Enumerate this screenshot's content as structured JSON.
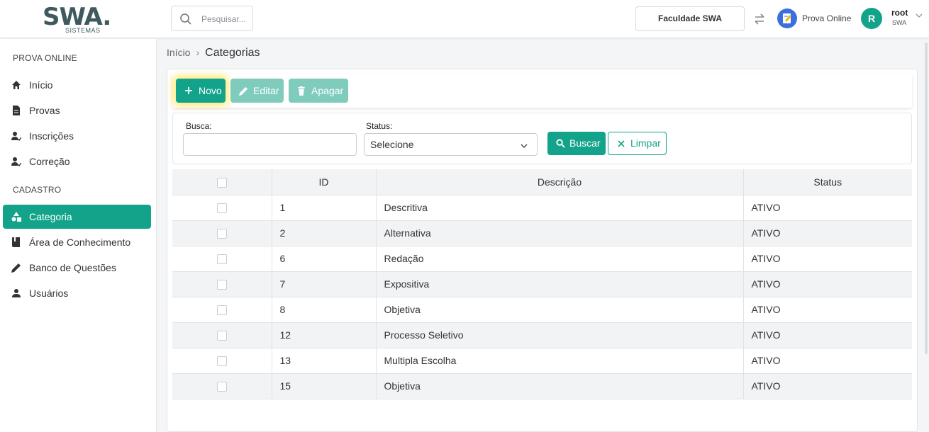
{
  "header": {
    "logo_text": "SWA",
    "logo_sub": "SISTEMAS",
    "search_placeholder": "Pesquisar...",
    "company": "Faculdade SWA",
    "app_label": "Prova Online",
    "avatar_letter": "R",
    "user_name": "root",
    "user_org": "SWA"
  },
  "sidebar": {
    "sections": [
      {
        "title": "PROVA ONLINE",
        "items": [
          {
            "label": "Início",
            "icon": "home-icon"
          },
          {
            "label": "Provas",
            "icon": "document-icon"
          },
          {
            "label": "Inscrições",
            "icon": "user-check-icon"
          },
          {
            "label": "Correção",
            "icon": "user-check-icon"
          }
        ]
      },
      {
        "title": "CADASTRO",
        "items": [
          {
            "label": "Categoria",
            "icon": "shapes-icon",
            "active": true
          },
          {
            "label": "Área de Conhecimento",
            "icon": "book-icon"
          },
          {
            "label": "Banco de Questões",
            "icon": "pencil-icon"
          },
          {
            "label": "Usuários",
            "icon": "user-icon"
          }
        ]
      }
    ]
  },
  "breadcrumb": {
    "home": "Início",
    "current": "Categorias"
  },
  "toolbar": {
    "new_label": "Novo",
    "edit_label": "Editar",
    "delete_label": "Apagar"
  },
  "filter": {
    "search_label": "Busca:",
    "search_value": "",
    "status_label": "Status:",
    "status_value": "Selecione",
    "search_button": "Buscar",
    "clear_button": "Limpar"
  },
  "table": {
    "columns": [
      "ID",
      "Descrição",
      "Status"
    ],
    "rows": [
      {
        "id": "1",
        "descricao": "Descritiva",
        "status": "ATIVO"
      },
      {
        "id": "2",
        "descricao": "Alternativa",
        "status": "ATIVO"
      },
      {
        "id": "6",
        "descricao": "Redação",
        "status": "ATIVO"
      },
      {
        "id": "7",
        "descricao": "Expositiva",
        "status": "ATIVO"
      },
      {
        "id": "8",
        "descricao": "Objetiva",
        "status": "ATIVO"
      },
      {
        "id": "12",
        "descricao": "Processo Seletivo",
        "status": "ATIVO"
      },
      {
        "id": "13",
        "descricao": "Multipla Escolha",
        "status": "ATIVO"
      },
      {
        "id": "15",
        "descricao": "Objetiva",
        "status": "ATIVO"
      }
    ]
  },
  "colors": {
    "accent": "#13a38a",
    "accent_disabled": "#7fccbd",
    "highlight": "#ffd600"
  }
}
